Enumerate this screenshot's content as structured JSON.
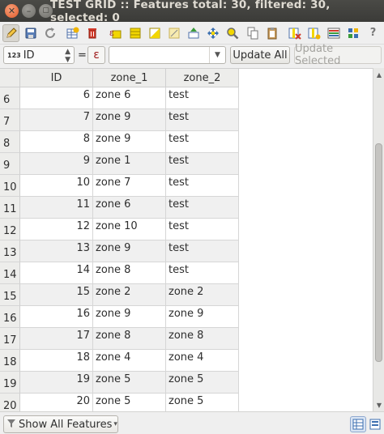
{
  "window": {
    "title": "TEST GRID :: Features total: 30, filtered: 30, selected: 0",
    "close_glyph": "✕",
    "minimize_glyph": "–",
    "maximize_glyph": "▢"
  },
  "toolbar": {
    "icons": [
      "edit-pencil-icon",
      "save-edits-icon",
      "reload-icon",
      "add-feature-icon",
      "delete-feature-icon",
      "select-by-expression-icon",
      "select-all-icon",
      "invert-selection-icon",
      "deselect-all-icon",
      "move-selection-to-top-icon",
      "pan-to-selection-icon",
      "zoom-to-selection-icon",
      "copy-rows-icon",
      "paste-features-icon",
      "delete-column-icon",
      "new-column-icon",
      "conditional-formatting-icon",
      "field-calculator-icon",
      "help-icon"
    ]
  },
  "filter": {
    "field_type_glyph": "123",
    "field_value": "ID",
    "operator": "=",
    "expression_glyph": "ε",
    "value": "",
    "update_all_label": "Update All",
    "update_selected_label": "Update Selected"
  },
  "table": {
    "columns": [
      "ID",
      "zone_1",
      "zone_2"
    ],
    "rows": [
      {
        "row": "6",
        "id": "6",
        "zone_1": "zone 6",
        "zone_2": "test"
      },
      {
        "row": "7",
        "id": "7",
        "zone_1": "zone 9",
        "zone_2": "test"
      },
      {
        "row": "8",
        "id": "8",
        "zone_1": "zone 9",
        "zone_2": "test"
      },
      {
        "row": "9",
        "id": "9",
        "zone_1": "zone 1",
        "zone_2": "test"
      },
      {
        "row": "10",
        "id": "10",
        "zone_1": "zone 7",
        "zone_2": "test"
      },
      {
        "row": "11",
        "id": "11",
        "zone_1": "zone 6",
        "zone_2": "test"
      },
      {
        "row": "12",
        "id": "12",
        "zone_1": "zone 10",
        "zone_2": "test"
      },
      {
        "row": "13",
        "id": "13",
        "zone_1": "zone 9",
        "zone_2": "test"
      },
      {
        "row": "14",
        "id": "14",
        "zone_1": "zone 8",
        "zone_2": "test"
      },
      {
        "row": "15",
        "id": "15",
        "zone_1": "zone 2",
        "zone_2": "zone 2"
      },
      {
        "row": "16",
        "id": "16",
        "zone_1": "zone 9",
        "zone_2": "zone 9"
      },
      {
        "row": "17",
        "id": "17",
        "zone_1": "zone 8",
        "zone_2": "zone 8"
      },
      {
        "row": "18",
        "id": "18",
        "zone_1": "zone 4",
        "zone_2": "zone 4"
      },
      {
        "row": "19",
        "id": "19",
        "zone_1": "zone 5",
        "zone_2": "zone 5"
      },
      {
        "row": "20",
        "id": "20",
        "zone_1": "zone 5",
        "zone_2": "zone 5"
      }
    ]
  },
  "footer": {
    "filter_label": "Show All Features"
  },
  "colors": {
    "titlebar": "#3c3b37",
    "close_button": "#e25b2a",
    "alt_row": "#f0f0f0"
  }
}
